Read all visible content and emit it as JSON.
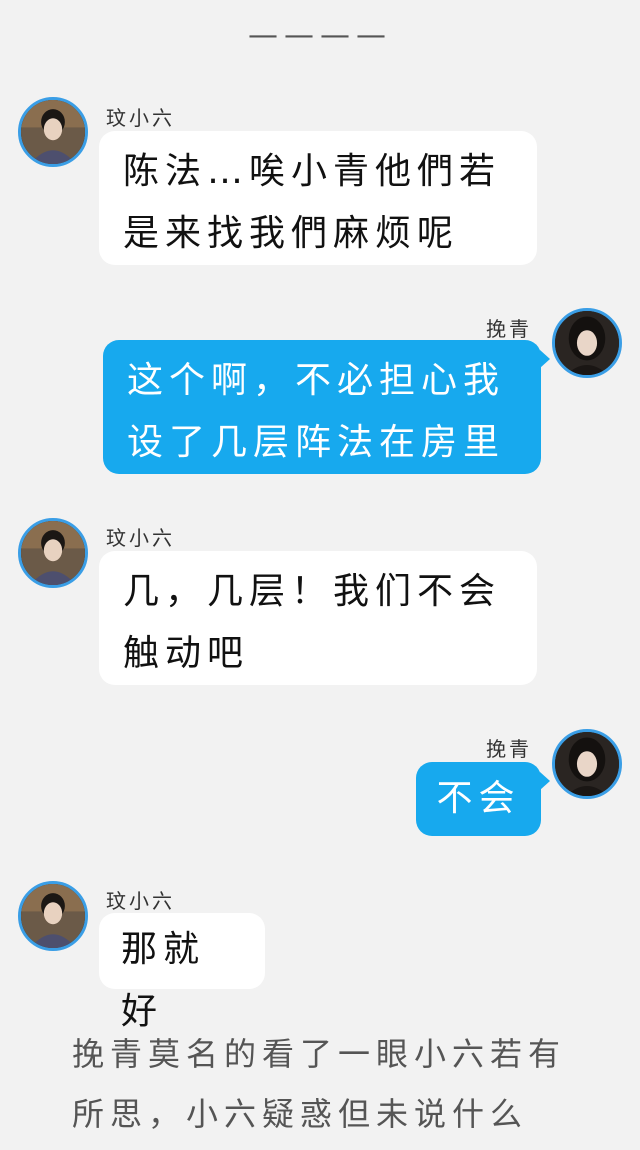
{
  "divider": "————",
  "messages": [
    {
      "speaker": "玟小六",
      "text": "陈法…唉小青他們若是来找我們麻烦呢"
    },
    {
      "speaker": "挽青",
      "text": "这个啊，不必担心我设了几层阵法在房里"
    },
    {
      "speaker": "玟小六",
      "text": "几，几层！我们不会触动吧"
    },
    {
      "speaker": "挽青",
      "text": "不会"
    },
    {
      "speaker": "玟小六",
      "text": "那就好"
    }
  ],
  "narration": "挽青莫名的看了一眼小六若有所思，小六疑惑但未说什么",
  "colors": {
    "background": "#f2f2f2",
    "outgoing_bubble": "#17a9ee",
    "incoming_bubble": "#ffffff",
    "avatar_ring": "#3a9ee6"
  }
}
